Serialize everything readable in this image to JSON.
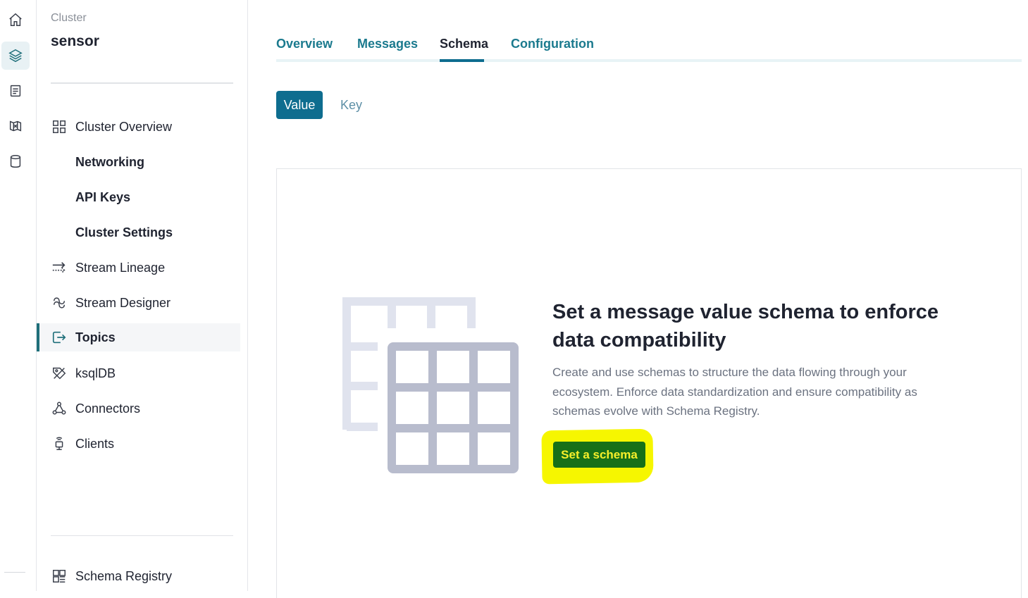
{
  "rail": {
    "icons": [
      "home-icon",
      "layers-icon",
      "document-icon",
      "map-icon",
      "database-icon"
    ]
  },
  "sidebar": {
    "breadcrumb": "Cluster",
    "cluster_name": "sensor",
    "items": [
      {
        "label": "Cluster Overview",
        "icon": "grid-icon"
      },
      {
        "label": "Networking"
      },
      {
        "label": "API Keys"
      },
      {
        "label": "Cluster Settings"
      },
      {
        "label": "Stream Lineage",
        "icon": "lineage-arrows-icon"
      },
      {
        "label": "Stream Designer",
        "icon": "stream-designer-icon"
      },
      {
        "label": "Topics",
        "icon": "topics-icon",
        "active": true
      },
      {
        "label": "ksqlDB",
        "icon": "ksqldb-icon"
      },
      {
        "label": "Connectors",
        "icon": "connectors-icon"
      },
      {
        "label": "Clients",
        "icon": "clients-icon"
      }
    ],
    "footer_item": {
      "label": "Schema Registry",
      "icon": "schema-registry-icon"
    }
  },
  "tabs": [
    {
      "label": "Overview"
    },
    {
      "label": "Messages"
    },
    {
      "label": "Schema",
      "active": true
    },
    {
      "label": "Configuration"
    }
  ],
  "schema_toggle": {
    "value_label": "Value",
    "key_label": "Key",
    "selected": "Value"
  },
  "empty_state": {
    "title": "Set a message value schema to enforce data compatibility",
    "description": "Create and use schemas to structure the data flowing through your ecosystem. Enforce data standardization and ensure compatibility as schemas evolve with Schema Registry.",
    "button_label": "Set a schema",
    "illustration": "table-grid-illustration"
  },
  "colors": {
    "accent": "#0e6d8f",
    "tab_text": "#1b7a8e",
    "cta_bg": "#177018",
    "cta_text": "#f7ef2a",
    "highlight": "#f6f600",
    "illus_light": "#e0e3ee",
    "illus_dark": "#b8bccd"
  }
}
